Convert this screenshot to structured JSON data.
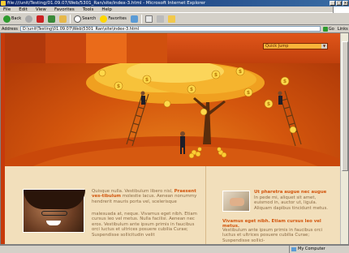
{
  "window": {
    "title": "file:///unit/Testing/01.09.07/Web/5301_Ran/site/index-3.html - Microsoft Internet Explorer"
  },
  "menu": {
    "items": [
      "File",
      "Edit",
      "View",
      "Favorites",
      "Tools",
      "Help"
    ]
  },
  "toolbar": {
    "back_label": "Back",
    "search_label": "Search",
    "favorites_label": "Favorites"
  },
  "addressbar": {
    "label": "Address",
    "value": "D:\\unit\\Testing\\01.09.07\\Web\\5301_Ran\\site\\index-3.html",
    "go_label": "Go",
    "links_label": "Links"
  },
  "site": {
    "quickjump_label": "Quick Jump",
    "left": {
      "text1_plain": "Quisque nulla. Vestibulum libero nisl, ",
      "text1_bold": "Praesent ves-tibulum",
      "text1_rest": " molestie lacus. Aenean nonummy hendrerit mauris porta vel, scelerisque",
      "text2": "malesuada at, neque. Vivamus eget nibh. Etiam cursus leo vel metus. Nulla facilisi. Aenean nec eros. Vestibulum ante ipsum primis in faucibus orci luctus et ultrices posuere cubilia Curae; Suspendisse sollicitudin velit"
    },
    "right": {
      "title": "Ut pharetra augue nec augue",
      "text1": "In pede mi, aliquet sit amet, euismod in, auctor ut, ligula. Aliquam dapibus tincidunt metus.",
      "heading2": "Vivamus eget nibh. Etiam cursus leo vel metus.",
      "text2": "Vestibulum ante ipsum primis in faucibus orci luctus et ultrices posuere cubilia Curae; Suspendisse sollici-"
    }
  },
  "statusbar": {
    "zone_label": "My Computer"
  },
  "colors": {
    "accent_orange": "#d2560e",
    "banner_red": "#c63a0a",
    "content_bg": "#f2dfbb",
    "titlebar_blue": "#0a246a"
  }
}
